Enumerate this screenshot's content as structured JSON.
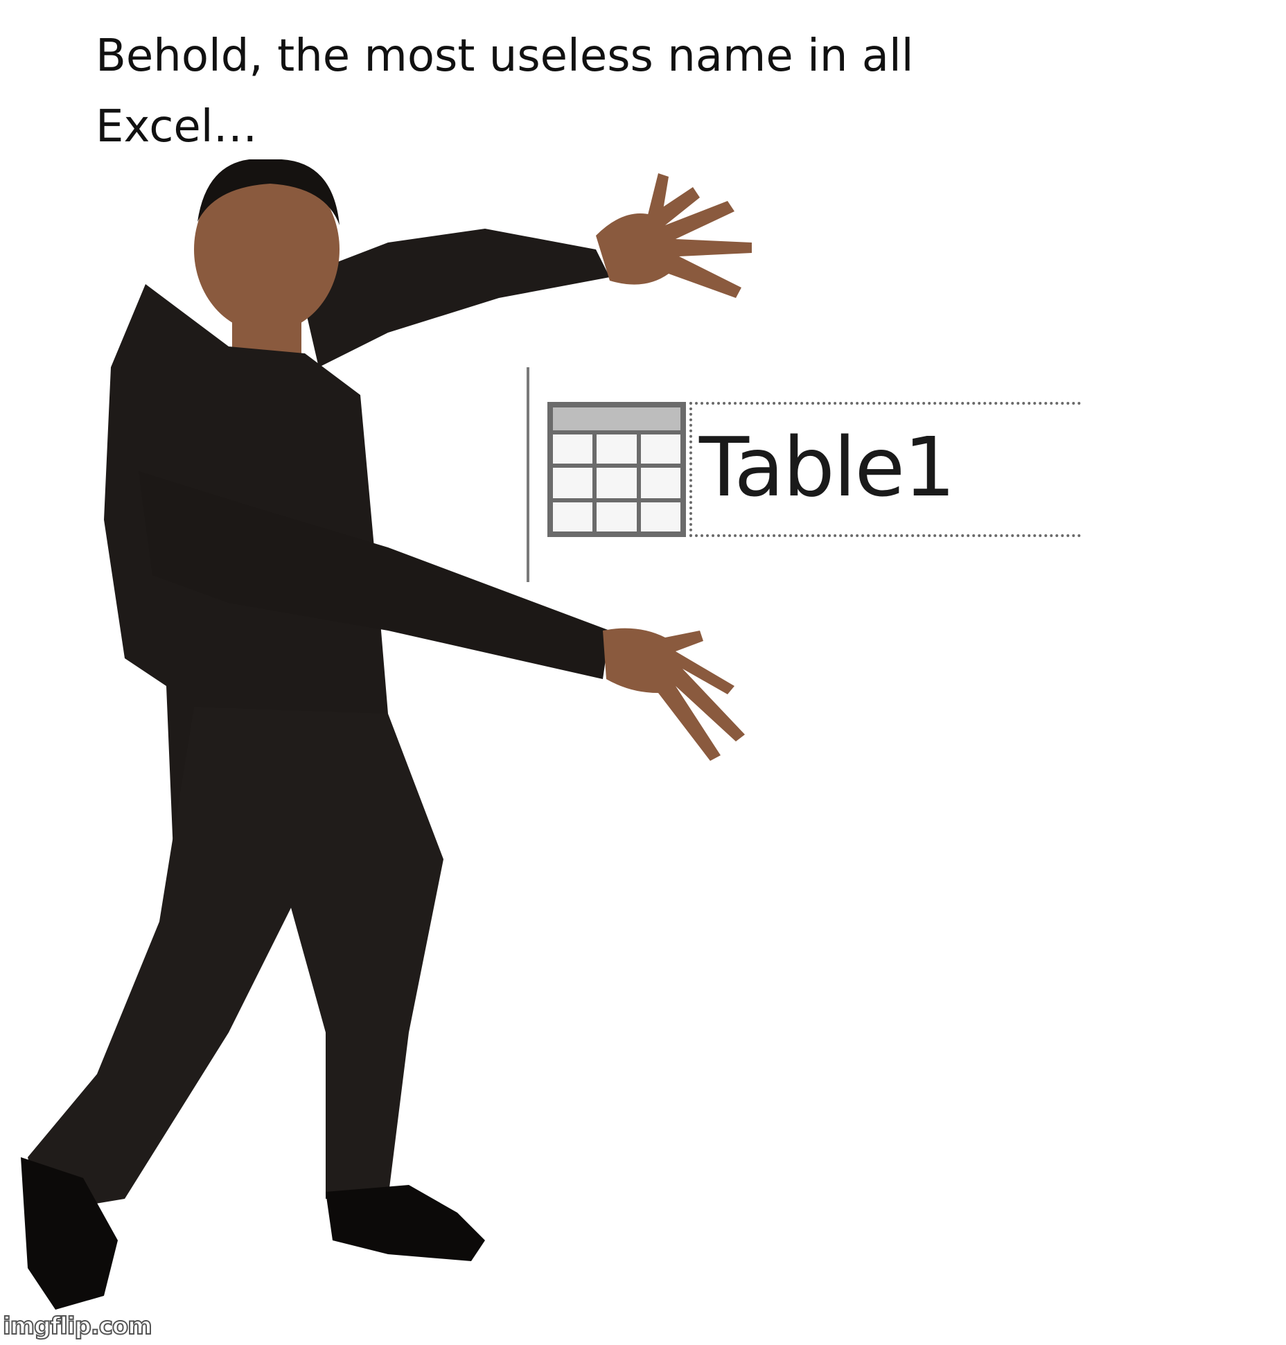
{
  "caption": {
    "line1": "Behold, the most useless name in all",
    "line2": "Excel…"
  },
  "name_box": {
    "value": "Table1",
    "icon": "table-icon"
  },
  "figure": {
    "icon": "person-presenting-figure"
  },
  "watermark": {
    "text": "imgflip.com"
  },
  "colors": {
    "background": "#ffffff",
    "suit": "#1e1a18",
    "skin": "#8a5a3e",
    "table_header": "#bdbdbd",
    "table_border": "#6b6b6b"
  }
}
